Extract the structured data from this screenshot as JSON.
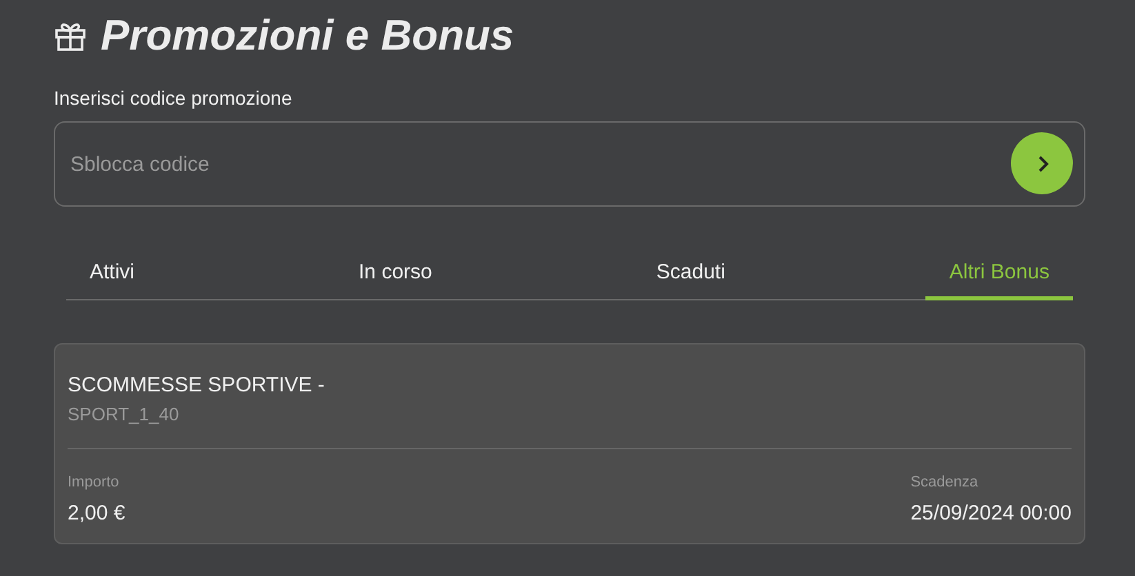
{
  "title": "Promozioni e Bonus",
  "promo_code": {
    "label": "Inserisci codice promozione",
    "placeholder": "Sblocca codice"
  },
  "tabs": [
    {
      "label": "Attivi",
      "selected": false
    },
    {
      "label": "In corso",
      "selected": false
    },
    {
      "label": "Scaduti",
      "selected": false
    },
    {
      "label": "Altri Bonus",
      "selected": true
    }
  ],
  "bonus_card": {
    "title": "SCOMMESSE SPORTIVE -",
    "code": "SPORT_1_40",
    "amount_label": "Importo",
    "amount": "2,00 €",
    "expiry_label": "Scadenza",
    "expiry": "25/09/2024 00:00"
  }
}
